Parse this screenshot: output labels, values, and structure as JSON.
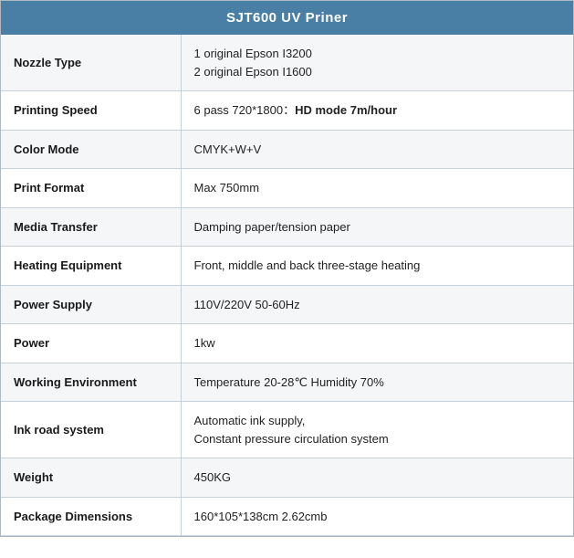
{
  "header": {
    "title": "SJT600 UV Priner"
  },
  "rows": [
    {
      "label": "Nozzle Type",
      "value_html": "1 original Epson I3200<br>2 original Epson I1600",
      "value_plain": "1 original Epson I3200\n2 original Epson I1600"
    },
    {
      "label": "Printing Speed",
      "value_html": "6 pass 720*1800：<strong>HD mode 7m/hour</strong>",
      "value_plain": "6 pass 720*1800： HD mode 7m/hour"
    },
    {
      "label": "Color Mode",
      "value_html": "CMYK+W+V",
      "value_plain": "CMYK+W+V"
    },
    {
      "label": "Print Format",
      "value_html": "Max 750mm",
      "value_plain": "Max 750mm"
    },
    {
      "label": "Media Transfer",
      "value_html": "Damping paper/tension paper",
      "value_plain": "Damping paper/tension paper"
    },
    {
      "label": "Heating Equipment",
      "value_html": "Front, middle and back three-stage heating",
      "value_plain": "Front, middle and back three-stage heating"
    },
    {
      "label": "Power Supply",
      "value_html": "110V/220V 50-60Hz",
      "value_plain": "110V/220V 50-60Hz"
    },
    {
      "label": "Power",
      "value_html": "1kw",
      "value_plain": "1kw"
    },
    {
      "label": "Working Environment",
      "value_html": "Temperature 20-28℃ Humidity 70%",
      "value_plain": "Temperature 20-28℃ Humidity 70%"
    },
    {
      "label": "Ink road system",
      "value_html": "Automatic ink supply,<br>Constant pressure circulation system",
      "value_plain": "Automatic ink supply,\nConstant pressure circulation system"
    },
    {
      "label": "Weight",
      "value_html": "450KG",
      "value_plain": "450KG"
    },
    {
      "label": "Package Dimensions",
      "value_html": "160*105*138cm 2.62cmb",
      "value_plain": "160*105*138cm 2.62cmb"
    }
  ]
}
